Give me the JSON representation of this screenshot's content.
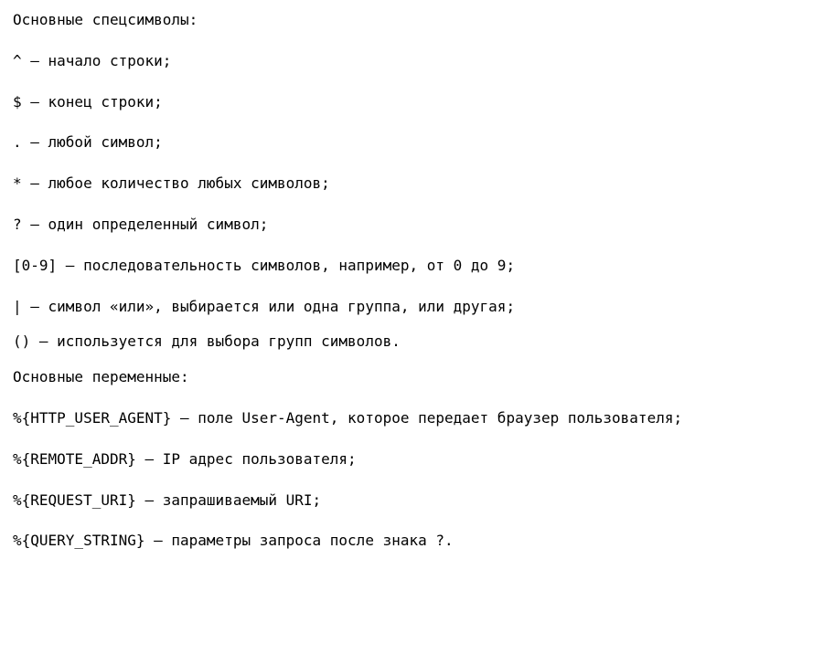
{
  "section1_heading": "Основные спецсимволы:",
  "specials": [
    "^ — начало строки;",
    "$ — конец строки;",
    ". — любой символ;",
    "* — любое количество любых символов;",
    "? — один определенный символ;",
    "[0-9] — последовательность символов, например, от 0 до 9;",
    "| — символ «или», выбирается или одна группа, или другая;",
    "() — используется для выбора групп символов."
  ],
  "section2_heading": "Основные переменные:",
  "vars": [
    "%{HTTP_USER_AGENT} — поле User-Agent, которое передает браузер пользователя;",
    "%{REMOTE_ADDR} — IP адрес пользователя;",
    "%{REQUEST_URI} — запрашиваемый URI;",
    "%{QUERY_STRING} — параметры запроса после знака ?."
  ]
}
